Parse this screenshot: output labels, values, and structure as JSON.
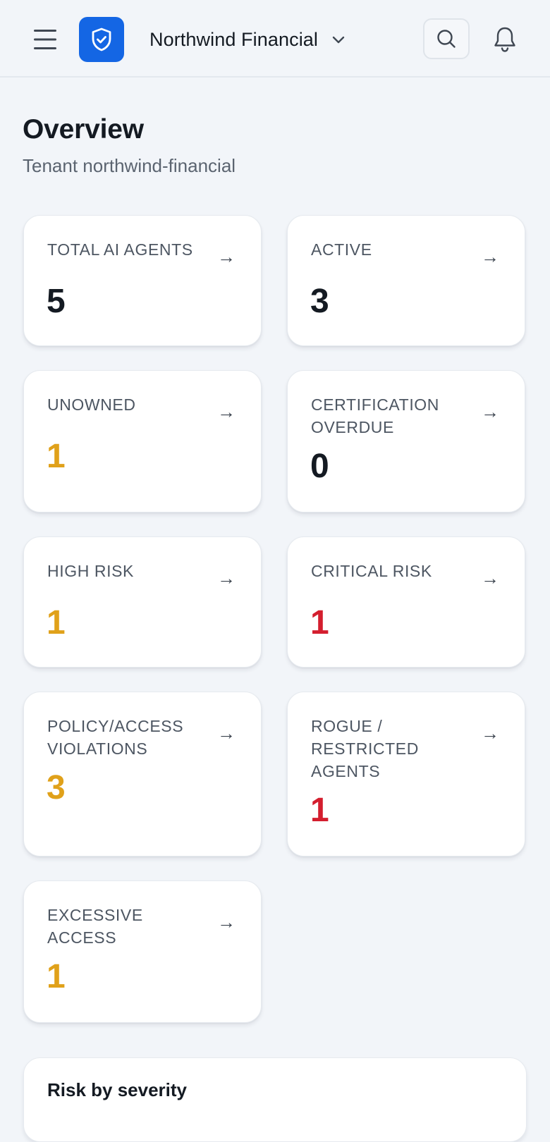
{
  "header": {
    "tenant_name": "Northwind Financial",
    "brand_color": "#1466e4"
  },
  "page": {
    "title": "Overview",
    "subtitle": "Tenant northwind-financial"
  },
  "metrics": [
    {
      "label": "Total AI agents",
      "value": "5",
      "arrow": "→",
      "status": "default"
    },
    {
      "label": "Active",
      "value": "3",
      "arrow": "→",
      "status": "default"
    },
    {
      "label": "Unowned",
      "value": "1",
      "arrow": "→",
      "status": "warning"
    },
    {
      "label": "Certification overdue",
      "value": "0",
      "arrow": "→",
      "status": "default"
    },
    {
      "label": "High risk",
      "value": "1",
      "arrow": "→",
      "status": "warning"
    },
    {
      "label": "Critical risk",
      "value": "1",
      "arrow": "→",
      "status": "critical"
    },
    {
      "label": "Policy/access violations",
      "value": "3",
      "arrow": "→",
      "status": "warning"
    },
    {
      "label": "Rogue / restricted agents",
      "value": "1",
      "arrow": "→",
      "status": "critical"
    },
    {
      "label": "Excessive access",
      "value": "1",
      "arrow": "→",
      "status": "warning"
    }
  ],
  "status_colors": {
    "default": "#141a22",
    "warning": "#e0a11a",
    "critical": "#d41e2e"
  },
  "sections": {
    "risk_by_severity_title": "Risk by severity"
  }
}
